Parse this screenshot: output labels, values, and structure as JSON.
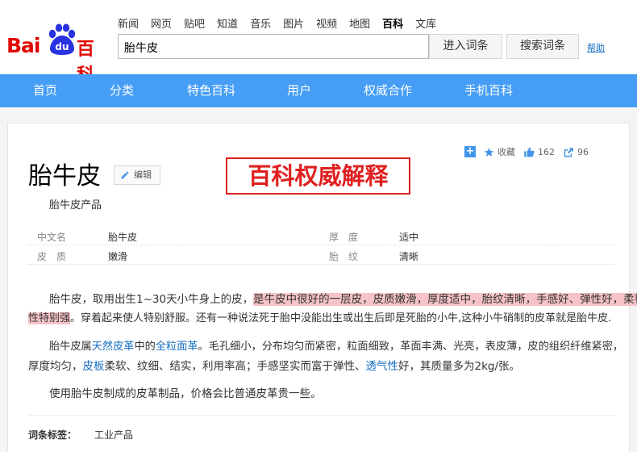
{
  "logo": {
    "bai": "Bai",
    "du": "du",
    "baike": "百科"
  },
  "topnav": [
    "新闻",
    "网页",
    "贴吧",
    "知道",
    "音乐",
    "图片",
    "视频",
    "地图",
    "百科",
    "文库"
  ],
  "search": {
    "value": "胎牛皮",
    "enter_label": "进入词条",
    "search_label": "搜索词条",
    "help_label": "帮助"
  },
  "mainnav": [
    "首页",
    "分类",
    "特色百科",
    "用户",
    "权威合作",
    "手机百科"
  ],
  "tools": {
    "collect_label": "收藏",
    "like_count": "162",
    "share_count": "96"
  },
  "entry": {
    "title": "胎牛皮",
    "edit_label": "编辑",
    "subtitle": "胎牛皮产品",
    "authority_label": "百科权威解释"
  },
  "info": [
    {
      "label": "中文名",
      "value": "胎牛皮",
      "label2": "厚　度",
      "value2": "适中"
    },
    {
      "label": "皮　质",
      "value": "嫩滑",
      "label2": "胎　纹",
      "value2": "清晰"
    }
  ],
  "para1": {
    "a": "胎牛皮，取用出生1~30天小牛身上的皮，",
    "hl1": "是牛皮中很好的一层皮，皮质嫩滑，厚度适中，胎纹清晰，手感好、弹性好，柔韧",
    "hl2": "性特别强",
    "b": "。穿着起来使人特别舒服。还有一种说法死于胎中没能出生或出生后即是死胎的小牛,这种小牛硝制的皮革就是胎牛皮."
  },
  "para2": {
    "a": "胎牛皮属",
    "link1": "天然皮革",
    "b": "中的",
    "link2": "全粒面革",
    "c": "。毛孔细小，分布均匀而紧密，粒面细致，革面丰满、光亮，表皮薄，皮的组织纤维紧密，",
    "d": "厚度均匀，",
    "link3": "皮板",
    "e": "柔软、纹细、结实，利用率高；手感坚实而富于弹性、",
    "link4": "透气性",
    "f": "好，其质量多为2kg/张。"
  },
  "para3": "使用胎牛皮制成的皮革制品，价格会比普通皮革贵一些。",
  "tags": {
    "label": "词条标签：",
    "value": "工业产品"
  },
  "colors": {
    "brand_red": "#e10601",
    "brand_blue": "#2932e1",
    "nav_blue": "#459df5",
    "link": "#136ec2",
    "highlight": "#f5c3c8"
  }
}
